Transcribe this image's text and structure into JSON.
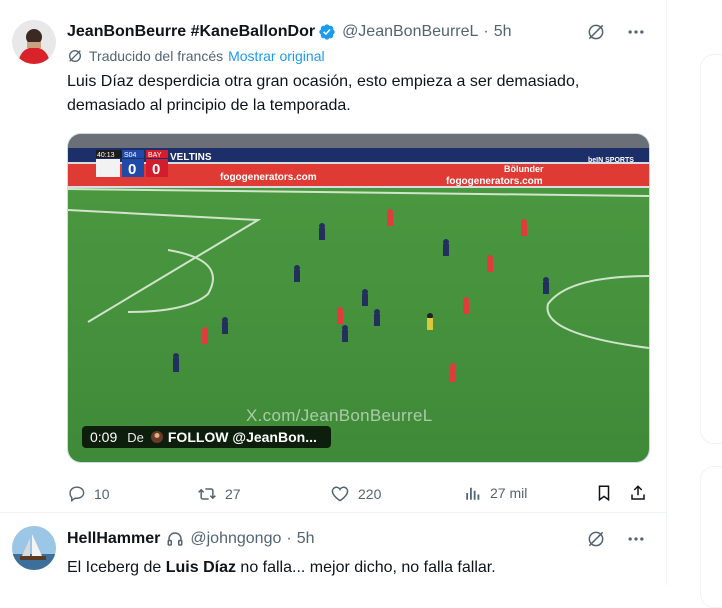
{
  "tweets": [
    {
      "display_name": "JeanBonBeurre #KaneBallonDor",
      "handle": "@JeanBonBeurreL",
      "dot": "·",
      "time": "5h",
      "translated_label": "Traducido del francés",
      "show_original": "Mostrar original",
      "text": "Luis Díaz desperdicia otra gran ocasión, esto empieza a ser demasiado, demasiado al principio de la temporada.",
      "video": {
        "time": "0:09",
        "from_label": "De",
        "follow_label": "FOLLOW @JeanBon...",
        "watermark": "X.com/JeanBonBeurreL",
        "scoreboard": {
          "clock": "40:13",
          "home": "S04",
          "away": "BAY",
          "home_score": "0",
          "away_score": "0"
        },
        "boards": [
          "VELTINS",
          "fogogenerators.com",
          "fogogenerators.com",
          "Bölunder",
          "beIN SPORTS"
        ]
      },
      "stats": {
        "replies": "10",
        "retweets": "27",
        "likes": "220",
        "views": "27 mil"
      }
    },
    {
      "display_name": "HellHammer",
      "handle": "@johngongo",
      "dot": "·",
      "time": "5h",
      "text_before": "El Iceberg de ",
      "text_bold": "Luis Díaz",
      "text_after": " no falla... mejor dicho, no falla fallar."
    }
  ],
  "colors": {
    "accent": "#1d9bf0",
    "secondary_text": "#536471",
    "pitch": "#3f8f3a"
  },
  "icons": [
    "verified-badge-icon",
    "translate-icon",
    "more-icon",
    "reply-icon",
    "retweet-icon",
    "like-icon",
    "views-icon",
    "bookmark-icon",
    "share-icon",
    "headphones-icon"
  ]
}
